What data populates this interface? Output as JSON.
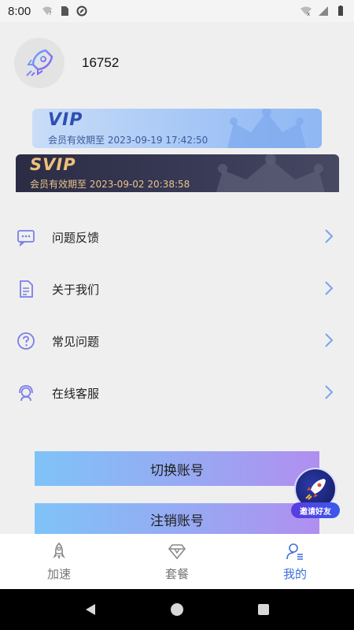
{
  "status_bar": {
    "time": "8:00"
  },
  "profile": {
    "username": "16752"
  },
  "vip": {
    "title": "VIP",
    "expire": "会员有效期至 2023-09-19 17:42:50"
  },
  "svip": {
    "title": "SVIP",
    "expire": "会员有效期至 2023-09-02 20:38:58"
  },
  "menu": {
    "items": [
      {
        "label": "问题反馈",
        "icon": "chat-icon"
      },
      {
        "label": "关于我们",
        "icon": "document-icon"
      },
      {
        "label": "常见问题",
        "icon": "question-icon"
      },
      {
        "label": "在线客服",
        "icon": "headset-icon"
      }
    ]
  },
  "buttons": {
    "switch_account": "切换账号",
    "logout": "注销账号"
  },
  "invite": {
    "label": "邀请好友"
  },
  "tabs": [
    {
      "label": "加速",
      "icon": "rocket-icon"
    },
    {
      "label": "套餐",
      "icon": "diamond-icon"
    },
    {
      "label": "我的",
      "icon": "user-icon"
    }
  ],
  "colors": {
    "accent": "#3f6fd8",
    "svip_gold": "#f0c07a",
    "vip_blue": "#2d4fb3"
  }
}
